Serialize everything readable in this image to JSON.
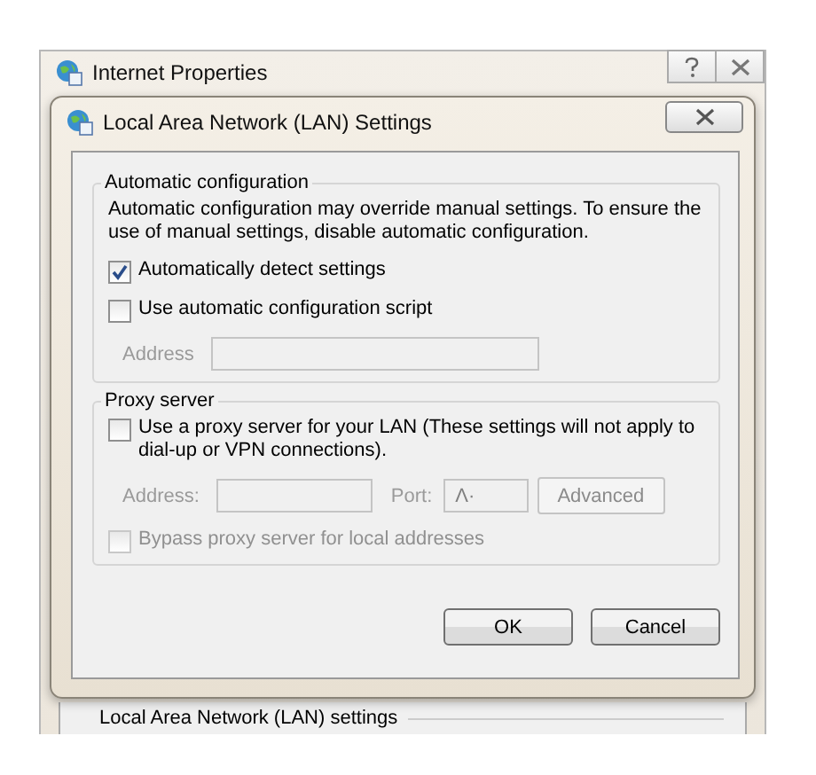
{
  "background_window": {
    "title": "Internet Properties",
    "section_label": "Local Area Network (LAN) settings"
  },
  "dialog": {
    "title": "Local Area Network (LAN) Settings",
    "groups": [
      {
        "title": "Automatic configuration",
        "items": [
          {
            "kind": "text",
            "text": "Automatic configuration may override manual settings.  To ensure the use of manual settings, disable automatic configuration."
          },
          {
            "kind": "checkbox",
            "label": "Automatically detect settings",
            "checked": true,
            "disabled": false
          },
          {
            "kind": "checkbox",
            "label": "Use automatic configuration script",
            "checked": false,
            "disabled": false
          },
          {
            "kind": "fields",
            "disabled": true,
            "fields": [
              {
                "kind": "field",
                "label": "Address"
              }
            ]
          }
        ]
      },
      {
        "title": "Proxy server",
        "items": [
          {
            "kind": "checkbox",
            "label": "Use a proxy server for your LAN (These settings will not apply to dial-up or VPN connections).",
            "checked": false,
            "disabled": false
          },
          {
            "kind": "fields",
            "disabled": true,
            "fields": [
              {
                "kind": "field",
                "label": "Address:"
              },
              {
                "kind": "field",
                "label": "Port:",
                "value": "Λ·"
              },
              {
                "kind": "button",
                "label": "Advanced"
              }
            ]
          },
          {
            "kind": "checkbox",
            "label": "Bypass proxy server for local addresses",
            "checked": false,
            "disabled": true
          }
        ]
      }
    ],
    "buttons": [
      "OK",
      "Cancel"
    ]
  }
}
